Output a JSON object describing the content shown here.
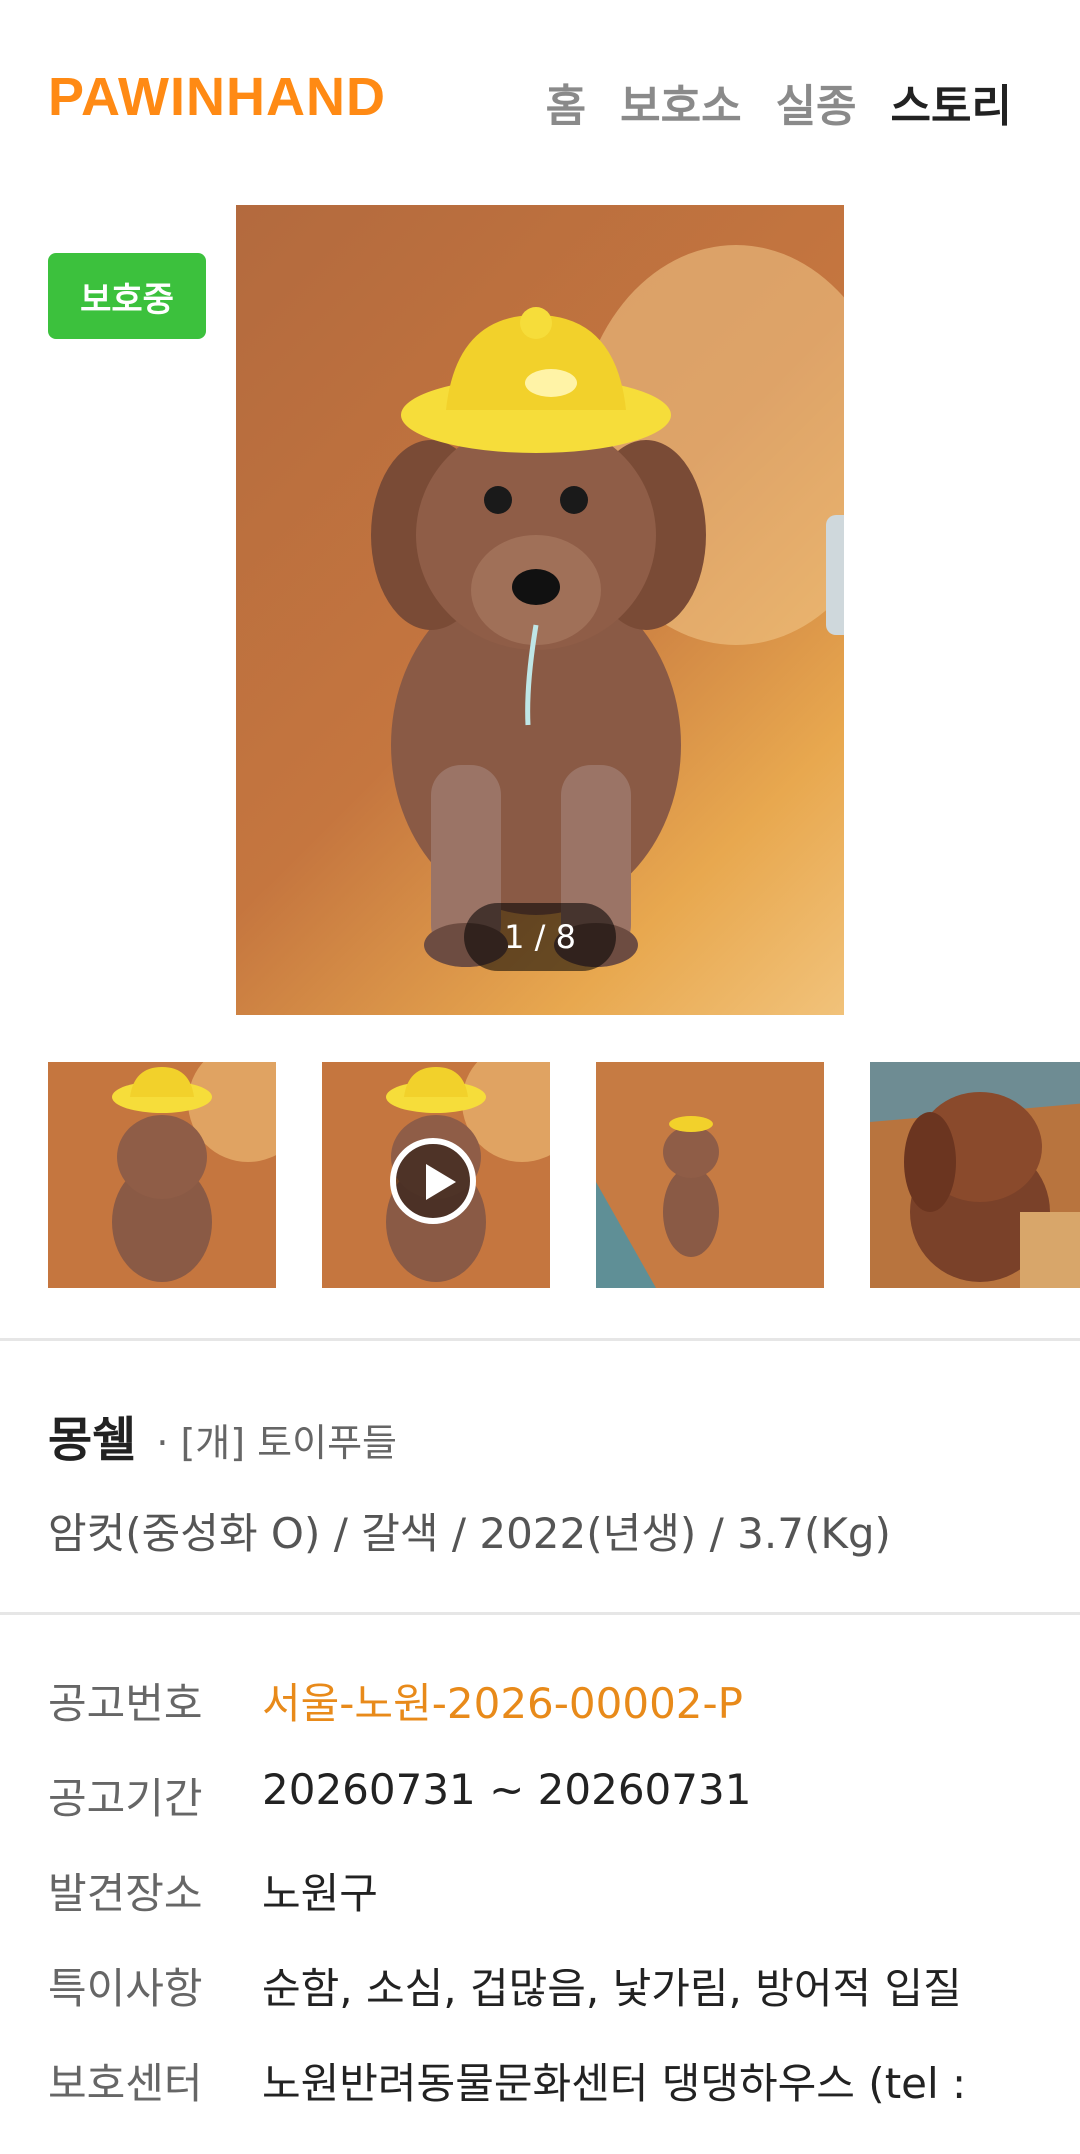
{
  "header": {
    "logo": "PAWINHAND",
    "nav": [
      {
        "label": "홈",
        "active": false
      },
      {
        "label": "보호소",
        "active": false
      },
      {
        "label": "실종",
        "active": false
      },
      {
        "label": "스토리",
        "active": true
      }
    ]
  },
  "status_badge": "보호중",
  "gallery": {
    "counter": "1 / 8",
    "thumbnails": [
      {
        "name": "photo-1",
        "is_video": false
      },
      {
        "name": "photo-2",
        "is_video": true
      },
      {
        "name": "photo-3",
        "is_video": false
      },
      {
        "name": "photo-4",
        "is_video": false
      }
    ]
  },
  "pet": {
    "name": "몽쉘",
    "breed": "· [개] 토이푸들",
    "attributes": "암컷(중성화 O) / 갈색 / 2022(년생) / 3.7(Kg)"
  },
  "details": {
    "notice_no_label": "공고번호",
    "notice_no": "서울-노원-2026-00002-P",
    "period_label": "공고기간",
    "period": "20260731 ~ 20260731",
    "location_label": "발견장소",
    "location": "노원구",
    "notes_label": "특이사항",
    "notes": "순함, 소심, 겁많음, 낯가림, 방어적 입질",
    "center_label": "보호센터",
    "center": "노원반려동물문화센터 댕댕하우스 (tel :"
  },
  "colors": {
    "brand": "#ff8a14",
    "badge": "#3cc13d",
    "accent": "#e88a1a"
  }
}
